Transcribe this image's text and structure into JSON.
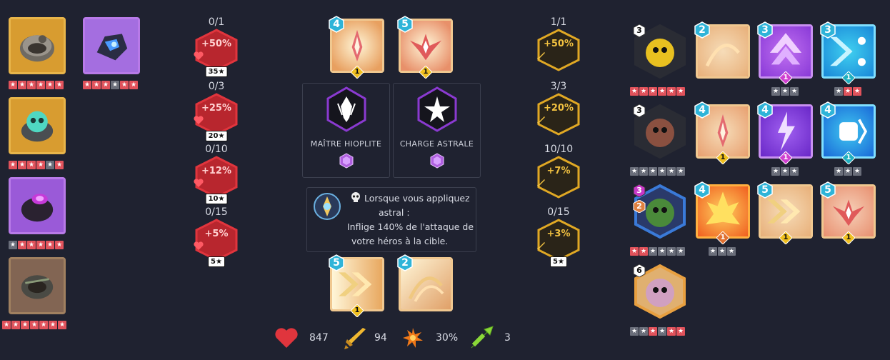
{
  "items": [
    {
      "name": "Anneau crâne",
      "stars": [
        "r",
        "r",
        "r",
        "r",
        "r",
        "r"
      ]
    },
    {
      "name": "Anneau vert",
      "stars": [
        "r",
        "r",
        "r",
        "r",
        "g",
        "r"
      ]
    },
    {
      "name": "Anneau violet",
      "stars": [
        "g",
        "r",
        "r",
        "r",
        "r",
        "r"
      ]
    },
    {
      "name": "Anneau sombre",
      "stars": [
        "r",
        "r",
        "r",
        "r",
        "r",
        "r",
        "r"
      ]
    },
    {
      "name": "Gant",
      "stars": [
        "r",
        "r",
        "r",
        "g",
        "r",
        "r"
      ]
    }
  ],
  "hp_talents": [
    {
      "count": "0/1",
      "bonus": "+50%",
      "stars": "35"
    },
    {
      "count": "0/3",
      "bonus": "+25%",
      "stars": "20"
    },
    {
      "count": "0/10",
      "bonus": "+12%",
      "stars": "10"
    },
    {
      "count": "0/15",
      "bonus": "+5%",
      "stars": "5"
    }
  ],
  "atk_talents": [
    {
      "count": "1/1",
      "bonus": "+50%",
      "stars": ""
    },
    {
      "count": "3/3",
      "bonus": "+20%",
      "stars": ""
    },
    {
      "count": "10/10",
      "bonus": "+7%",
      "stars": ""
    },
    {
      "count": "0/15",
      "bonus": "+3%",
      "stars": "5"
    }
  ],
  "top_skills": [
    {
      "level": "4",
      "sub": "1"
    },
    {
      "level": "5",
      "sub": "1"
    }
  ],
  "special_talents": [
    {
      "name": "MAÎTRE HIOPLITE"
    },
    {
      "name": "CHARGE ASTRALE"
    }
  ],
  "tooltip": {
    "line1": "Lorsque vous appliquez",
    "line2": "astral :",
    "line3": "Inflige 140% de l'attaque de",
    "line4": "votre héros à la cible."
  },
  "bottom_skills": [
    {
      "level": "5",
      "sub": "1"
    },
    {
      "level": "2",
      "sub": ""
    }
  ],
  "stats": {
    "hp": "847",
    "attack": "94",
    "crit": "30%",
    "speed": "3"
  },
  "heroes": [
    {
      "level": "3",
      "level2": "",
      "stars": [
        "r",
        "r",
        "r",
        "r",
        "r",
        "r"
      ]
    },
    {
      "level": "3",
      "level2": "",
      "stars": [
        "g",
        "g",
        "g",
        "g",
        "g",
        "g"
      ]
    },
    {
      "level": "3",
      "level2": "2",
      "stars": [
        "r",
        "r",
        "g",
        "g",
        "g",
        "g"
      ]
    },
    {
      "level": "6",
      "level2": "",
      "stars": [
        "g",
        "g",
        "r",
        "g",
        "r",
        "r"
      ]
    }
  ],
  "hero_skills": [
    [
      {
        "level": "2",
        "sub": "",
        "stars": ""
      },
      {
        "level": "3",
        "sub": "1",
        "stars": "ggg"
      },
      {
        "level": "3",
        "sub": "1",
        "stars": "grr"
      }
    ],
    [
      {
        "level": "4",
        "sub": "1",
        "stars": ""
      },
      {
        "level": "4",
        "sub": "1",
        "stars": "ggg"
      },
      {
        "level": "4",
        "sub": "1",
        "stars": "ggg"
      }
    ],
    [
      {
        "level": "4",
        "sub": "1",
        "stars": "ggg"
      },
      {
        "level": "5",
        "sub": "1",
        "stars": ""
      },
      {
        "level": "5",
        "sub": "1",
        "stars": ""
      }
    ]
  ],
  "colors": {
    "background": "#1f2230",
    "hp_red": "#c8353d",
    "atk_gold": "#e0a824",
    "level_cyan": "#2fb4d8",
    "purple": "#9b4de0"
  }
}
